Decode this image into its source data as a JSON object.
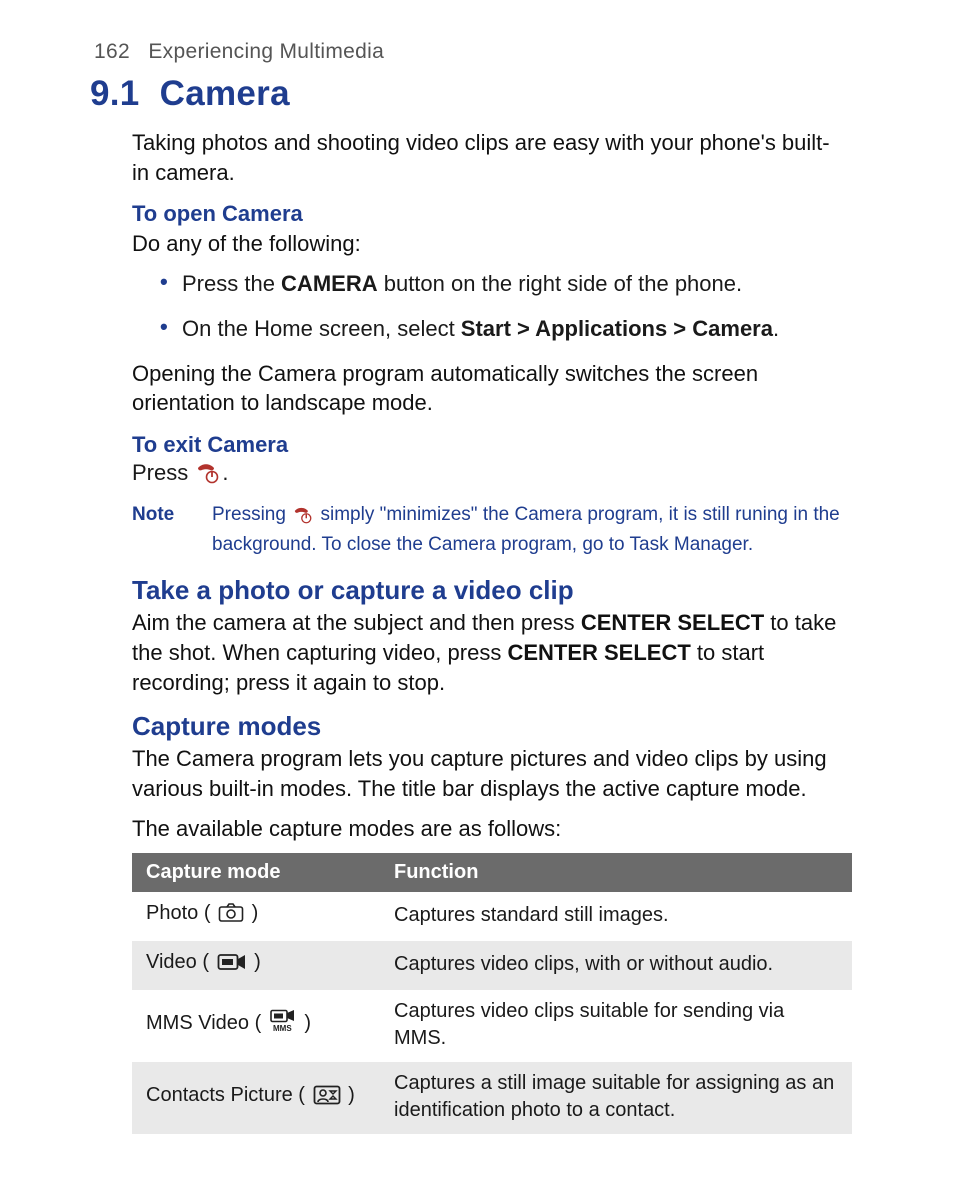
{
  "header": {
    "page_number": "162",
    "chapter_title": "Experiencing Multimedia"
  },
  "section": {
    "number": "9.1",
    "title": "Camera"
  },
  "intro": "Taking photos and shooting video clips are easy with your phone's built-in camera.",
  "open_camera": {
    "heading": "To open Camera",
    "lead": "Do any of the following:",
    "bullet1_pre": "Press the ",
    "bullet1_bold": "CAMERA",
    "bullet1_post": " button on the right side of the phone.",
    "bullet2_pre": "On the Home screen, select ",
    "bullet2_bold": "Start > Applications > Camera",
    "bullet2_post": "."
  },
  "open_para": "Opening the Camera program automatically switches the screen orientation to landscape mode.",
  "exit_camera": {
    "heading": "To exit Camera",
    "press_pre": "Press ",
    "press_post": "."
  },
  "note": {
    "label": "Note",
    "text_pre": "Pressing ",
    "text_post": " simply \"minimizes\" the Camera program, it is still runing in the background. To close the Camera program, go to Task Manager."
  },
  "take_photo": {
    "heading": "Take a photo or capture a video clip",
    "text_pre1": "Aim the camera at the subject and then press ",
    "bold1": "CENTER SELECT",
    "text_mid": " to take the shot. When capturing video, press ",
    "bold2": "CENTER SELECT",
    "text_post": " to start recording; press it again to stop."
  },
  "capture_modes": {
    "heading": "Capture modes",
    "para1": "The Camera program lets you capture pictures and video clips by using various built-in modes. The title bar displays the active capture mode.",
    "para2": "The available capture modes are as follows:",
    "table": {
      "col1": "Capture mode",
      "col2": "Function",
      "rows": [
        {
          "mode": "Photo",
          "icon": "camera-icon",
          "func": "Captures standard still images."
        },
        {
          "mode": "Video",
          "icon": "video-icon",
          "func": "Captures video clips, with or without audio."
        },
        {
          "mode": "MMS Video",
          "icon": "mms-video-icon",
          "func": "Captures video clips suitable for sending via MMS."
        },
        {
          "mode": "Contacts Picture",
          "icon": "contacts-picture-icon",
          "func": "Captures a still image suitable for assigning as an identification photo to a contact."
        }
      ]
    }
  }
}
